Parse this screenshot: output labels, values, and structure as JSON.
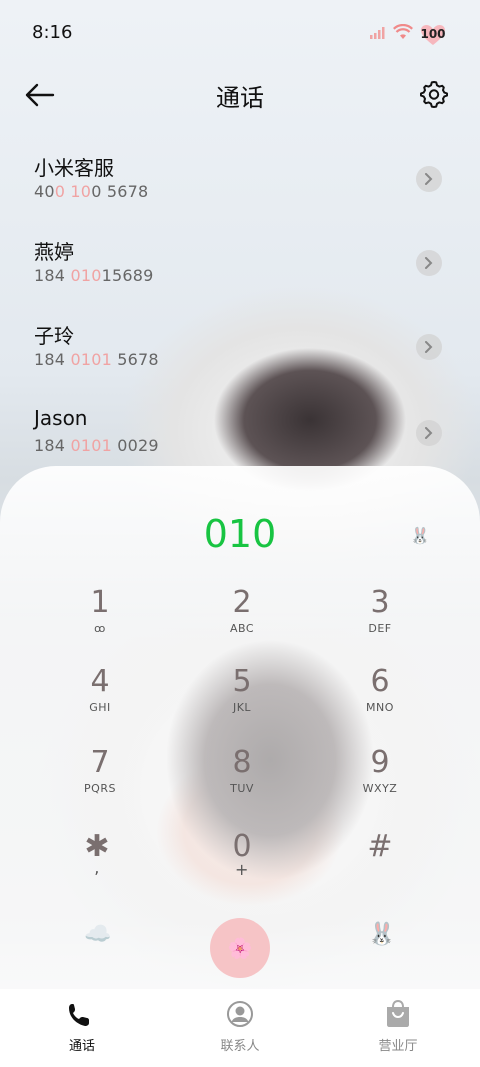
{
  "status_bar": {
    "time": "8:16",
    "battery": "100"
  },
  "header": {
    "title": "通话"
  },
  "contacts": [
    {
      "name": "小米客服",
      "num_pre": "40",
      "num_hl": "0 10",
      "num_post": "0 5678"
    },
    {
      "name": "燕婷",
      "num_pre": "184 ",
      "num_hl": "010",
      "num_post": "15689"
    },
    {
      "name": "子玲",
      "num_pre": "184 ",
      "num_hl": "0101",
      "num_post": " 5678"
    },
    {
      "name": "Jason",
      "num_pre": "184 ",
      "num_hl": "0101",
      "num_post": " 0029"
    }
  ],
  "dialer": {
    "input": "010",
    "keys": [
      {
        "digit": "1",
        "letters": "ꝏ"
      },
      {
        "digit": "2",
        "letters": "ABC"
      },
      {
        "digit": "3",
        "letters": "DEF"
      },
      {
        "digit": "4",
        "letters": "GHI"
      },
      {
        "digit": "5",
        "letters": "JKL"
      },
      {
        "digit": "6",
        "letters": "MNO"
      },
      {
        "digit": "7",
        "letters": "PQRS"
      },
      {
        "digit": "8",
        "letters": "TUV"
      },
      {
        "digit": "9",
        "letters": "WXYZ"
      },
      {
        "digit": "✱",
        "letters": ","
      },
      {
        "digit": "0",
        "letters": "+"
      },
      {
        "digit": "#",
        "letters": ""
      }
    ]
  },
  "nav": {
    "calls": "通话",
    "contacts": "联系人",
    "store": "营业厅"
  },
  "colors": {
    "accent_green": "#18c442",
    "highlight_pink": "#f0a3a3",
    "call_button": "#f6c4c6"
  },
  "icons": {
    "back": "arrow-left-icon",
    "settings": "gear-icon",
    "chevron": "chevron-right-icon"
  }
}
